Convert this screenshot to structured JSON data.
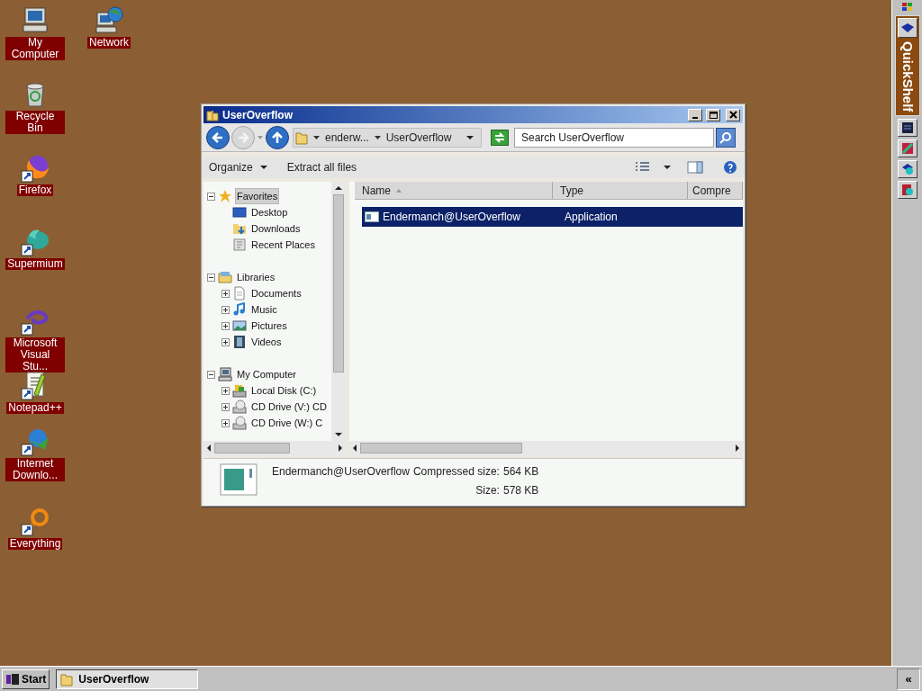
{
  "desktop_icons": [
    {
      "label": "My Computer",
      "kind": "computer"
    },
    {
      "label": "Network",
      "kind": "network"
    },
    {
      "label": "Recycle Bin",
      "kind": "bin"
    },
    {
      "label": "Firefox",
      "kind": "firefox"
    },
    {
      "label": "Supermium",
      "kind": "supermium"
    },
    {
      "label": "Microsoft Visual Stu...",
      "kind": "vs"
    },
    {
      "label": "Notepad++",
      "kind": "notepad"
    },
    {
      "label": "Internet Downlo...",
      "kind": "idm"
    },
    {
      "label": "Everything",
      "kind": "everything"
    }
  ],
  "window": {
    "title": "UserOverflow",
    "address": {
      "segments": [
        "enderw...",
        "UserOverflow"
      ]
    },
    "search": {
      "placeholder": "Search UserOverflow"
    },
    "toolbar": [
      {
        "label": "Organize",
        "dropdown": true
      },
      {
        "label": "Extract all files",
        "dropdown": false
      }
    ],
    "tree": [
      {
        "label": "Favorites",
        "kind": "star",
        "expanded": true,
        "selected": true,
        "children": [
          {
            "label": "Desktop",
            "kind": "desktop",
            "selected": false
          },
          {
            "label": "Downloads",
            "kind": "downloads",
            "selected": false
          },
          {
            "label": "Recent Places",
            "kind": "recent",
            "selected": false
          }
        ]
      },
      {
        "label": "Libraries",
        "kind": "libraries",
        "expanded": true,
        "selected": false,
        "children": [
          {
            "label": "Documents",
            "kind": "documents",
            "expanded": false,
            "selected": false
          },
          {
            "label": "Music",
            "kind": "music",
            "expanded": false,
            "selected": false
          },
          {
            "label": "Pictures",
            "kind": "pictures",
            "expanded": false,
            "selected": false
          },
          {
            "label": "Videos",
            "kind": "videos",
            "expanded": false,
            "selected": false
          }
        ]
      },
      {
        "label": "My Computer",
        "kind": "computer",
        "expanded": true,
        "selected": false,
        "children": [
          {
            "label": "Local Disk (C:)",
            "kind": "disk",
            "expanded": false,
            "selected": false
          },
          {
            "label": "CD Drive (V:) CD",
            "kind": "cd",
            "expanded": false,
            "selected": false
          },
          {
            "label": "CD Drive (W:) C",
            "kind": "cd",
            "expanded": false,
            "selected": false
          }
        ]
      }
    ],
    "table": {
      "columns": [
        "Name",
        "Type",
        "Compre"
      ],
      "rows": [
        {
          "name": "Endermanch@UserOverflow",
          "type": "Application",
          "selected": true
        }
      ]
    },
    "details": {
      "name": "Endermanch@UserOverflow",
      "fields": [
        {
          "label": "Compressed size:",
          "value": "564 KB"
        },
        {
          "label": "Size:",
          "value": "578 KB"
        }
      ]
    }
  },
  "quickshelf": {
    "title": "QuickShelf"
  },
  "taskbar": {
    "start": "Start",
    "tasks": [
      {
        "label": "UserOverflow",
        "selected": true
      }
    ],
    "chevron": "«"
  }
}
